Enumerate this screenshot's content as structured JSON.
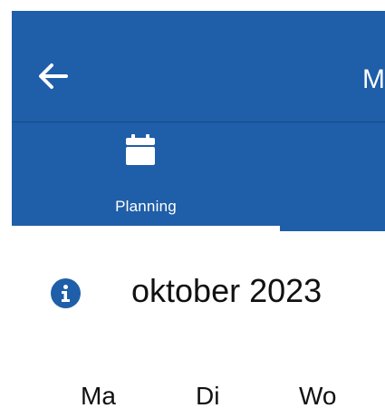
{
  "header": {
    "title_fragment": "M",
    "back_icon": "arrow-left-icon"
  },
  "tabs": [
    {
      "label": "Planning",
      "icon": "calendar-icon",
      "selected": true
    }
  ],
  "calendar": {
    "info_icon": "info-icon",
    "month_title": "oktober 2023",
    "weekdays": [
      "Ma",
      "Di",
      "Wo"
    ]
  },
  "colors": {
    "primary": "#1f5ea8",
    "on_primary": "#ffffff",
    "info": "#1f5ea8",
    "text": "#111111"
  }
}
